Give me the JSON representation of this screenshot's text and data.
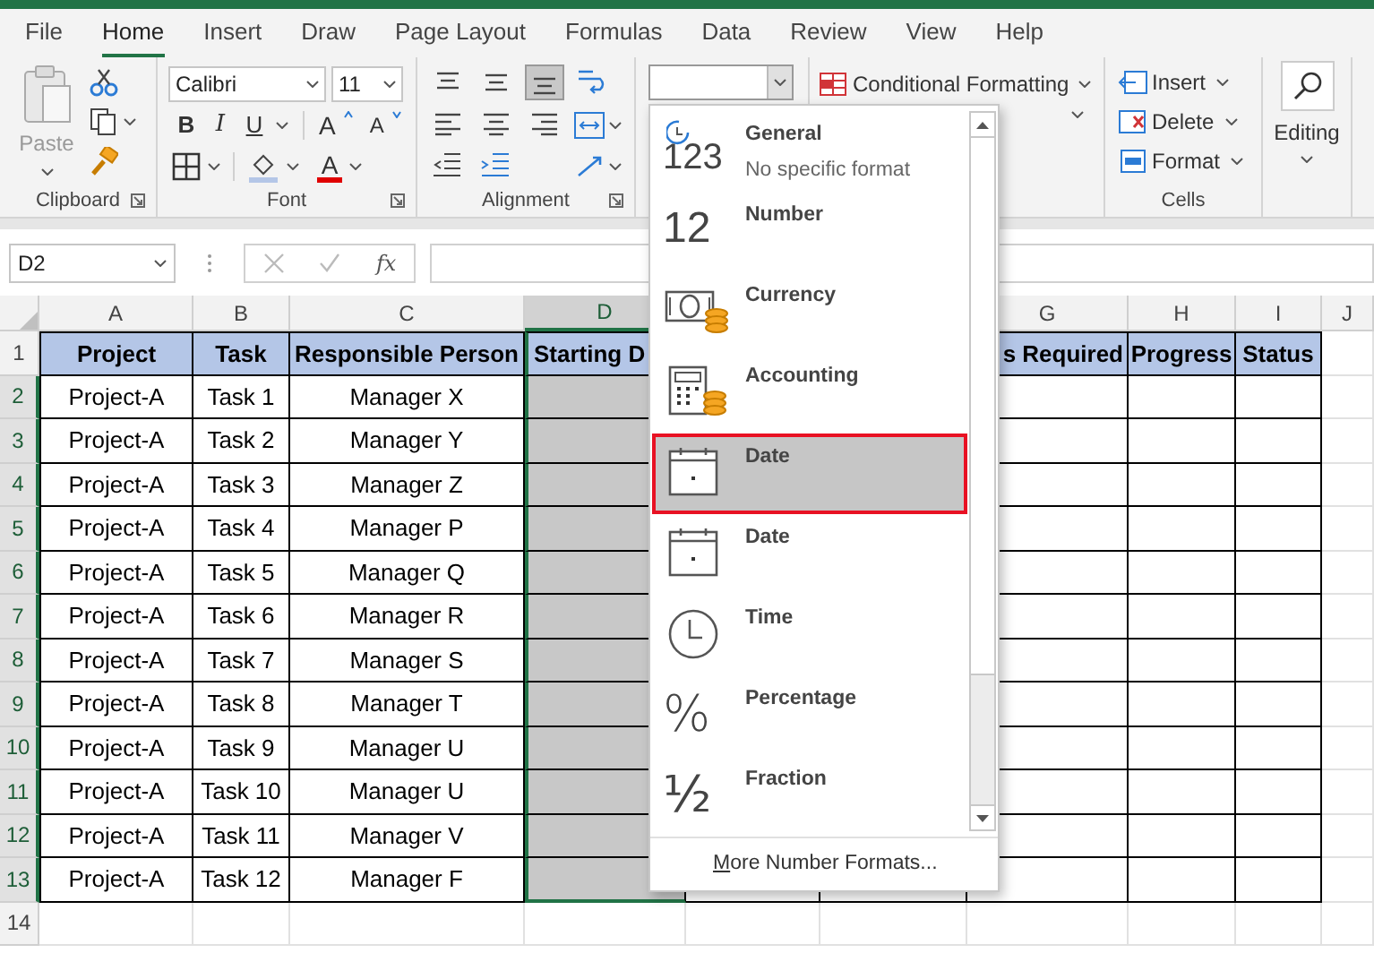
{
  "tabs": [
    {
      "label": "File",
      "selected": false
    },
    {
      "label": "Home",
      "selected": true
    },
    {
      "label": "Insert",
      "selected": false
    },
    {
      "label": "Draw",
      "selected": false
    },
    {
      "label": "Page Layout",
      "selected": false
    },
    {
      "label": "Formulas",
      "selected": false
    },
    {
      "label": "Data",
      "selected": false
    },
    {
      "label": "Review",
      "selected": false
    },
    {
      "label": "View",
      "selected": false
    },
    {
      "label": "Help",
      "selected": false
    }
  ],
  "ribbon": {
    "clipboard": {
      "paste": "Paste",
      "label": "Clipboard"
    },
    "font": {
      "name": "Calibri",
      "size": "11",
      "bold": "B",
      "italic": "I",
      "underline": "U",
      "grow": "A",
      "shrink": "A",
      "font_color": "A",
      "label": "Font"
    },
    "alignment": {
      "vertical": [
        {
          "kind": "top",
          "selected": false
        },
        {
          "kind": "middle",
          "selected": false
        },
        {
          "kind": "bottom",
          "selected": true
        }
      ],
      "label": "Alignment"
    },
    "styles": {
      "conditional_formatting": "Conditional Formatting"
    },
    "cells": {
      "items": [
        {
          "kind": "insert",
          "label": "Insert"
        },
        {
          "kind": "delete",
          "label": "Delete"
        },
        {
          "kind": "format",
          "label": "Format"
        }
      ],
      "label": "Cells"
    },
    "editing": {
      "label": "Editing"
    }
  },
  "formula_bar": {
    "name_box": "D2",
    "function_label": "fx"
  },
  "sheet": {
    "header_row_number": "1",
    "columns": [
      {
        "letter": "A",
        "header": "Project",
        "selected": false
      },
      {
        "letter": "B",
        "header": "Task",
        "selected": false
      },
      {
        "letter": "C",
        "header": "Responsible Person",
        "selected": false
      },
      {
        "letter": "D",
        "header": "Starting D",
        "selected": true
      },
      {
        "letter": "G",
        "header": "s Required",
        "selected": false
      },
      {
        "letter": "H",
        "header": "Progress",
        "selected": false
      },
      {
        "letter": "I",
        "header": "Status",
        "selected": false
      },
      {
        "letter": "J",
        "selected": false
      }
    ],
    "rows": [
      {
        "number": "2",
        "selected": true,
        "cells": [
          "Project-A",
          "Task 1",
          "Manager X"
        ]
      },
      {
        "number": "3",
        "selected": true,
        "cells": [
          "Project-A",
          "Task 2",
          "Manager Y"
        ]
      },
      {
        "number": "4",
        "selected": true,
        "cells": [
          "Project-A",
          "Task 3",
          "Manager Z"
        ]
      },
      {
        "number": "5",
        "selected": true,
        "cells": [
          "Project-A",
          "Task 4",
          "Manager P"
        ]
      },
      {
        "number": "6",
        "selected": true,
        "cells": [
          "Project-A",
          "Task 5",
          "Manager Q"
        ]
      },
      {
        "number": "7",
        "selected": true,
        "cells": [
          "Project-A",
          "Task 6",
          "Manager R"
        ]
      },
      {
        "number": "8",
        "selected": true,
        "cells": [
          "Project-A",
          "Task 7",
          "Manager S"
        ]
      },
      {
        "number": "9",
        "selected": true,
        "cells": [
          "Project-A",
          "Task 8",
          "Manager T"
        ]
      },
      {
        "number": "10",
        "selected": true,
        "cells": [
          "Project-A",
          "Task 9",
          "Manager U"
        ]
      },
      {
        "number": "11",
        "selected": true,
        "cells": [
          "Project-A",
          "Task 10",
          "Manager U"
        ]
      },
      {
        "number": "12",
        "selected": true,
        "cells": [
          "Project-A",
          "Task 11",
          "Manager V"
        ]
      },
      {
        "number": "13",
        "selected": true,
        "cells": [
          "Project-A",
          "Task 12",
          "Manager F"
        ]
      },
      {
        "number": "14",
        "selected": false
      }
    ]
  },
  "number_format_menu": {
    "items": [
      {
        "kind": "general",
        "glyph": "123",
        "label": "General",
        "description": "No specific format",
        "selected": false
      },
      {
        "kind": "number",
        "glyph": "12",
        "label": "Number",
        "selected": false
      },
      {
        "kind": "currency",
        "label": "Currency",
        "selected": false
      },
      {
        "kind": "accounting",
        "label": "Accounting",
        "selected": false
      },
      {
        "kind": "date",
        "label": "Date",
        "selected": true
      },
      {
        "kind": "date",
        "label": "Date",
        "selected": false
      },
      {
        "kind": "time",
        "label": "Time",
        "selected": false
      },
      {
        "kind": "percentage",
        "glyph": "%",
        "label": "Percentage",
        "selected": false
      },
      {
        "kind": "fraction",
        "glyph": "½",
        "label": "Fraction",
        "selected": false
      }
    ],
    "footer": "More Number Formats..."
  }
}
